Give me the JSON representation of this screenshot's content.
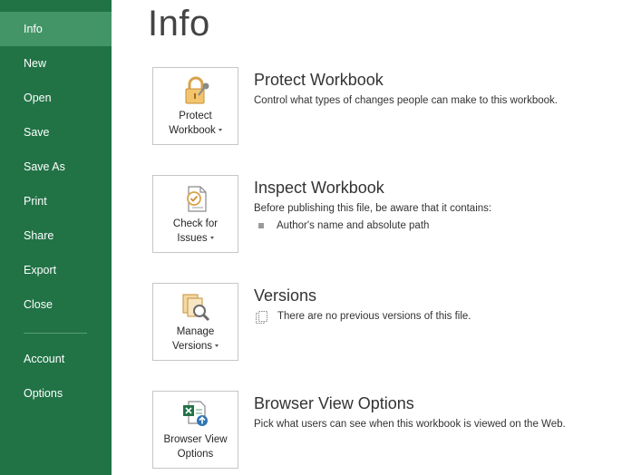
{
  "sidebar": {
    "items": [
      {
        "label": "Info",
        "active": true
      },
      {
        "label": "New"
      },
      {
        "label": "Open"
      },
      {
        "label": "Save"
      },
      {
        "label": "Save As"
      },
      {
        "label": "Print"
      },
      {
        "label": "Share"
      },
      {
        "label": "Export"
      },
      {
        "label": "Close"
      },
      {
        "label": "Account"
      },
      {
        "label": "Options"
      }
    ]
  },
  "page": {
    "title": "Info"
  },
  "sections": [
    {
      "tile_line1": "Protect",
      "tile_line2": "Workbook",
      "icon": "lock-icon",
      "title": "Protect Workbook",
      "description": "Control what types of changes people can make to this workbook."
    },
    {
      "tile_line1": "Check for",
      "tile_line2": "Issues",
      "icon": "check-issues-icon",
      "title": "Inspect Workbook",
      "description": "Before publishing this file, be aware that it contains:",
      "bullets": [
        "Author's name and absolute path"
      ]
    },
    {
      "tile_line1": "Manage",
      "tile_line2": "Versions",
      "icon": "manage-versions-icon",
      "title": "Versions",
      "description": "There are no previous versions of this file."
    },
    {
      "tile_line1": "Browser View",
      "tile_line2": "Options",
      "icon": "browser-view-icon",
      "title": "Browser View Options",
      "description": "Pick what users can see when this workbook is viewed on the Web."
    }
  ],
  "colors": {
    "sidebar": "#217346",
    "sidebar_active": "#439467",
    "tile_border": "#c6c6c6"
  }
}
